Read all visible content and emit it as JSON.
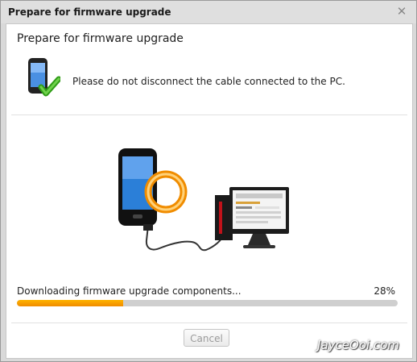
{
  "window": {
    "title": "Prepare for firmware upgrade",
    "close_icon": "close-icon"
  },
  "dialog": {
    "heading": "Prepare for firmware upgrade",
    "notice": "Please do not disconnect the cable connected to the PC.",
    "notice_icon": "phone-check-icon",
    "illustration": "phone-to-pc-connection"
  },
  "progress": {
    "label": "Downloading firmware upgrade components...",
    "percent_text": "28%",
    "value": 0.28,
    "color": "#f5a000"
  },
  "buttons": {
    "cancel": "Cancel"
  },
  "watermark": "JayceOoi.com"
}
